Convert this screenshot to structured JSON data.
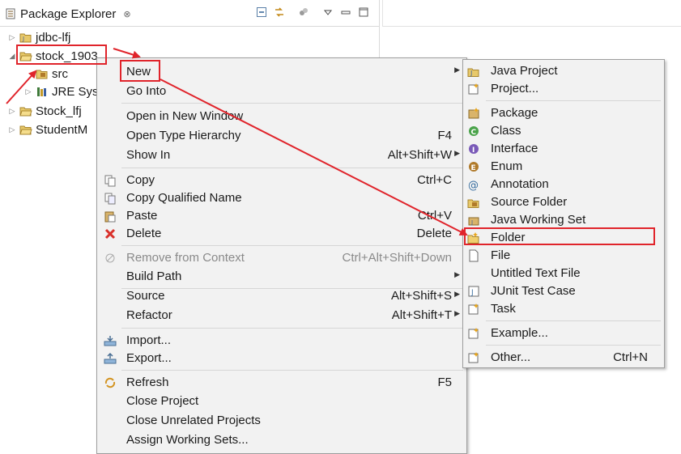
{
  "view": {
    "title": "Package Explorer",
    "close_glyph": "⊗",
    "icons": [
      "collapse-all-icon",
      "link-with-editor-icon",
      "filter-icon",
      "view-menu-icon",
      "minimize-icon",
      "maximize-icon"
    ]
  },
  "tree": [
    {
      "label": "jdbc-lfj",
      "icon": "project-icon"
    },
    {
      "label": "stock_1903",
      "icon": "project-open-icon"
    },
    {
      "label": "src",
      "icon": "source-folder-icon"
    },
    {
      "label": "JRE Syst",
      "icon": "library-icon"
    },
    {
      "label": "Stock_lfj",
      "icon": "project-icon"
    },
    {
      "label": "StudentM",
      "icon": "project-icon"
    }
  ],
  "context_menu": [
    {
      "label": "New",
      "accel": "",
      "submenu": true
    },
    {
      "label": "Go Into",
      "accel": ""
    },
    {
      "label": "Open in New Window",
      "accel": ""
    },
    {
      "label": "Open Type Hierarchy",
      "accel": "F4"
    },
    {
      "label": "Show In",
      "accel": "Alt+Shift+W",
      "submenu": true
    },
    {
      "label": "Copy",
      "accel": "Ctrl+C",
      "icon": "copy-icon"
    },
    {
      "label": "Copy Qualified Name",
      "accel": "",
      "icon": "copy-qualified-icon"
    },
    {
      "label": "Paste",
      "accel": "Ctrl+V",
      "icon": "paste-icon"
    },
    {
      "label": "Delete",
      "accel": "Delete",
      "icon": "delete-icon"
    },
    {
      "label": "Remove from Context",
      "accel": "Ctrl+Alt+Shift+Down",
      "icon": "remove-context-icon",
      "disabled": true
    },
    {
      "label": "Build Path",
      "accel": "",
      "submenu": true
    },
    {
      "label": "Source",
      "accel": "Alt+Shift+S",
      "submenu": true
    },
    {
      "label": "Refactor",
      "accel": "Alt+Shift+T",
      "submenu": true
    },
    {
      "label": "Import...",
      "accel": "",
      "icon": "import-icon"
    },
    {
      "label": "Export...",
      "accel": "",
      "icon": "export-icon"
    },
    {
      "label": "Refresh",
      "accel": "F5",
      "icon": "refresh-icon"
    },
    {
      "label": "Close Project",
      "accel": ""
    },
    {
      "label": "Close Unrelated Projects",
      "accel": ""
    },
    {
      "label": "Assign Working Sets...",
      "accel": ""
    }
  ],
  "submenu": [
    {
      "label": "Java Project",
      "accel": "",
      "icon": "java-project-icon"
    },
    {
      "label": "Project...",
      "accel": "",
      "icon": "new-project-icon"
    },
    {
      "label": "Package",
      "accel": "",
      "icon": "package-icon"
    },
    {
      "label": "Class",
      "accel": "",
      "icon": "class-icon"
    },
    {
      "label": "Interface",
      "accel": "",
      "icon": "interface-icon"
    },
    {
      "label": "Enum",
      "accel": "",
      "icon": "enum-icon"
    },
    {
      "label": "Annotation",
      "accel": "",
      "icon": "annotation-icon"
    },
    {
      "label": "Source Folder",
      "accel": "",
      "icon": "source-folder-icon"
    },
    {
      "label": "Java Working Set",
      "accel": "",
      "icon": "working-set-icon"
    },
    {
      "label": "Folder",
      "accel": "",
      "icon": "folder-icon"
    },
    {
      "label": "File",
      "accel": "",
      "icon": "file-icon"
    },
    {
      "label": "Untitled Text File",
      "accel": "",
      "icon": "text-file-icon"
    },
    {
      "label": "JUnit Test Case",
      "accel": "",
      "icon": "junit-icon"
    },
    {
      "label": "Task",
      "accel": "",
      "icon": "task-icon"
    },
    {
      "label": "Example...",
      "accel": "",
      "icon": "example-icon"
    },
    {
      "label": "Other...",
      "accel": "Ctrl+N",
      "icon": "other-wizard-icon"
    }
  ],
  "colors": {
    "highlight": "#e0242b",
    "menu_bg": "#f2f2f2"
  }
}
